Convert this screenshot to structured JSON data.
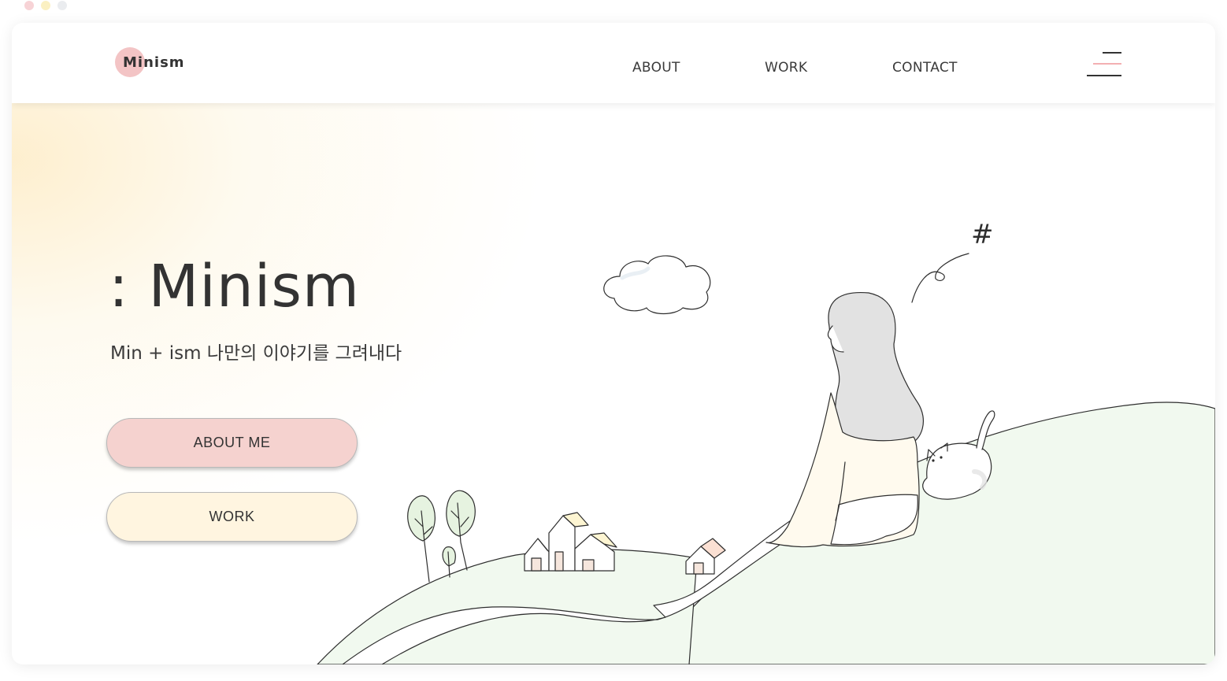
{
  "colors": {
    "accent_pink": "#f3c4c5",
    "button_pink": "#f5d2cf",
    "button_cream": "#fff5e0",
    "hill_green": "#f1f9ef",
    "text_dark": "#333333"
  },
  "header": {
    "logo_text": "Minism",
    "nav": [
      "ABOUT",
      "WORK",
      "CONTACT"
    ],
    "menu_icon": "hamburger-icon"
  },
  "hero": {
    "title": ": Minism",
    "subtitle": "Min + ism   나만의 이야기를 그려내다",
    "buttons": [
      "ABOUT ME",
      "WORK"
    ]
  },
  "illustration": {
    "symbol": "#",
    "elements": [
      "cloud",
      "girl",
      "cat",
      "trees",
      "houses",
      "hills",
      "path"
    ]
  }
}
